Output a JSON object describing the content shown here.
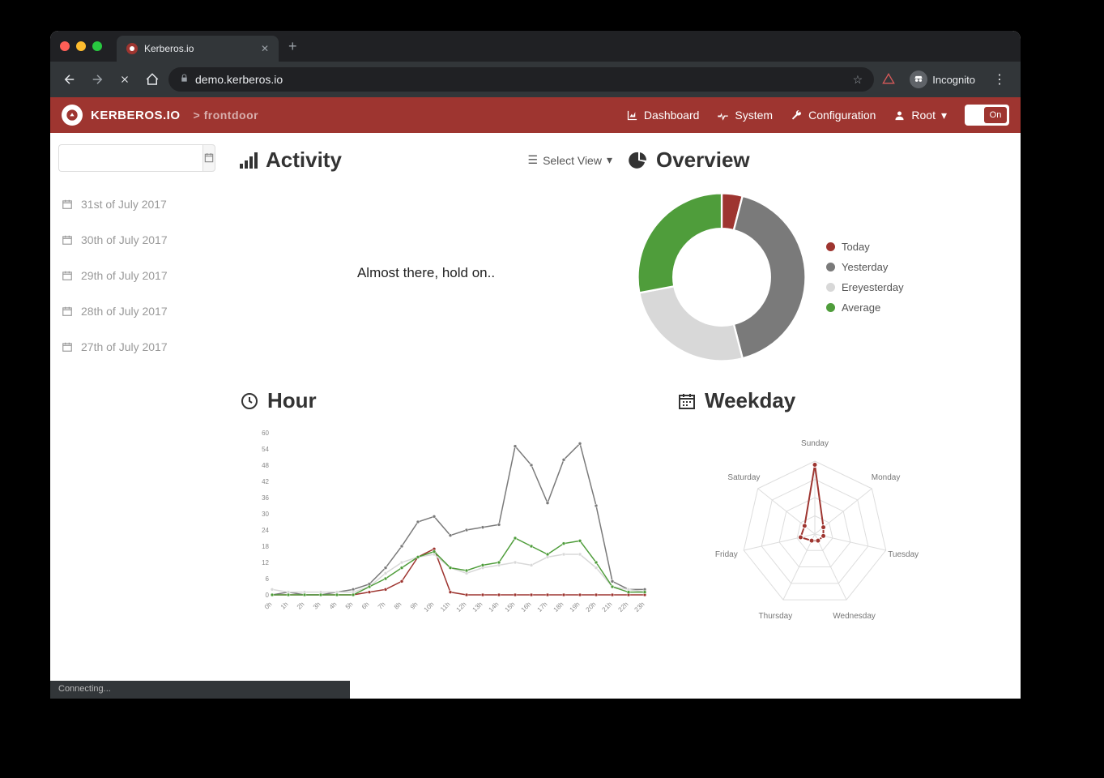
{
  "browser": {
    "tab_title": "Kerberos.io",
    "url_host": "demo.kerberos.io",
    "incognito_label": "Incognito",
    "status": "Connecting..."
  },
  "topnav": {
    "brand": "KERBEROS.IO",
    "breadcrumb_prefix": ">",
    "breadcrumb": "frontdoor",
    "items": {
      "dashboard": "Dashboard",
      "system": "System",
      "configuration": "Configuration",
      "user": "Root"
    },
    "toggle_label": "On"
  },
  "sidebar": {
    "dates": [
      "31st of July 2017",
      "30th of July 2017",
      "29th of July 2017",
      "28th of July 2017",
      "27th of July 2017"
    ]
  },
  "sections": {
    "activity": {
      "title": "Activity",
      "select_view": "Select View",
      "loading": "Almost there, hold on.."
    },
    "overview": {
      "title": "Overview"
    },
    "hour": {
      "title": "Hour"
    },
    "weekday": {
      "title": "Weekday"
    }
  },
  "legend": {
    "today": "Today",
    "yesterday": "Yesterday",
    "ereyesterday": "Ereyesterday",
    "average": "Average"
  },
  "colors": {
    "today": "#9e3530",
    "yesterday": "#7a7a7a",
    "ereyesterday": "#d8d8d8",
    "average": "#4f9d3b"
  },
  "chart_data": [
    {
      "id": "overview_donut",
      "type": "pie",
      "title": "Overview",
      "series": [
        {
          "name": "Today",
          "value": 4,
          "color": "#9e3530"
        },
        {
          "name": "Yesterday",
          "value": 42,
          "color": "#7a7a7a"
        },
        {
          "name": "Ereyesterday",
          "value": 26,
          "color": "#d8d8d8"
        },
        {
          "name": "Average",
          "value": 28,
          "color": "#4f9d3b"
        }
      ]
    },
    {
      "id": "hour_line",
      "type": "line",
      "title": "Hour",
      "xlabel": "",
      "ylabel": "",
      "categories": [
        "0h",
        "1h",
        "2h",
        "3h",
        "4h",
        "5h",
        "6h",
        "7h",
        "8h",
        "9h",
        "10h",
        "11h",
        "12h",
        "13h",
        "14h",
        "15h",
        "16h",
        "17h",
        "18h",
        "19h",
        "20h",
        "21h",
        "22h",
        "23h"
      ],
      "ylim": [
        0,
        60
      ],
      "yticks": [
        0,
        6,
        12,
        18,
        24,
        30,
        36,
        42,
        48,
        54,
        60
      ],
      "series": [
        {
          "name": "Today",
          "color": "#9e3530",
          "values": [
            0,
            0,
            0,
            0,
            0,
            0,
            1,
            2,
            5,
            14,
            17,
            1,
            0,
            0,
            0,
            0,
            0,
            0,
            0,
            0,
            0,
            0,
            0,
            0
          ]
        },
        {
          "name": "Yesterday",
          "color": "#7a7a7a",
          "values": [
            0,
            1,
            0,
            0,
            1,
            2,
            4,
            10,
            18,
            27,
            29,
            22,
            24,
            25,
            26,
            55,
            48,
            34,
            50,
            56,
            33,
            5,
            2,
            2
          ]
        },
        {
          "name": "Ereyesterday",
          "color": "#d8d8d8",
          "values": [
            2,
            1,
            1,
            1,
            1,
            1,
            3,
            8,
            12,
            14,
            15,
            10,
            8,
            10,
            11,
            12,
            11,
            14,
            15,
            15,
            10,
            3,
            2,
            1
          ]
        },
        {
          "name": "Average",
          "color": "#4f9d3b",
          "values": [
            0,
            0,
            0,
            0,
            0,
            0,
            3,
            6,
            10,
            14,
            16,
            10,
            9,
            11,
            12,
            21,
            18,
            15,
            19,
            20,
            12,
            3,
            1,
            1
          ]
        }
      ]
    },
    {
      "id": "weekday_radar",
      "type": "radar",
      "title": "Weekday",
      "categories": [
        "Sunday",
        "Monday",
        "Tuesday",
        "Wednesday",
        "Thursday",
        "Friday",
        "Saturday"
      ],
      "range": [
        0,
        100
      ],
      "series": [
        {
          "name": "Activity",
          "color": "#9e3530",
          "values": [
            95,
            15,
            12,
            10,
            10,
            20,
            18
          ]
        }
      ]
    }
  ]
}
